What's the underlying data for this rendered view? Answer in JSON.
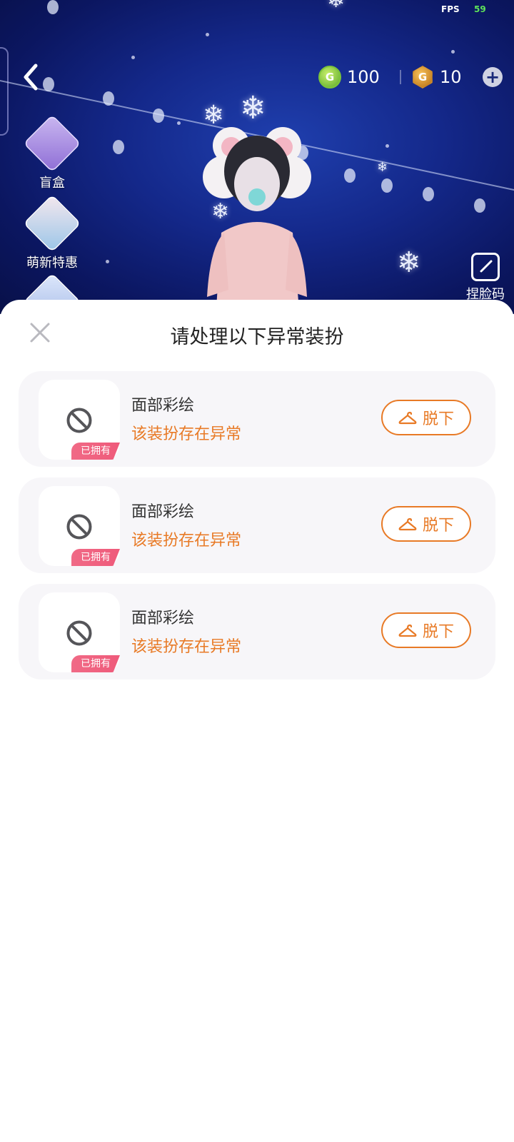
{
  "status": {
    "fps_label": "FPS",
    "fps_value": "59"
  },
  "header": {
    "currency_green": {
      "value": "100",
      "icon": "g-coin-green-icon"
    },
    "currency_gold": {
      "value": "10",
      "icon": "g-coin-gold-icon"
    },
    "add_label": "+"
  },
  "sidebar": {
    "items": [
      {
        "label": "盲盒",
        "icon": "gift-box-icon"
      },
      {
        "label": "萌新特惠",
        "icon": "newbie-deal-icon"
      }
    ]
  },
  "pinch_face": {
    "label": "捏脸码",
    "icon": "edit-face-icon"
  },
  "sheet": {
    "title": "请处理以下异常装扮",
    "items": [
      {
        "name": "面部彩绘",
        "status": "该装扮存在异常",
        "badge": "已拥有",
        "action": "脱下"
      },
      {
        "name": "面部彩绘",
        "status": "该装扮存在异常",
        "badge": "已拥有",
        "action": "脱下"
      },
      {
        "name": "面部彩绘",
        "status": "该装扮存在异常",
        "badge": "已拥有",
        "action": "脱下"
      }
    ]
  },
  "colors": {
    "accent_orange": "#e87a26",
    "badge_pink": "#ef5a7a",
    "scene_blue": "#14288a"
  }
}
